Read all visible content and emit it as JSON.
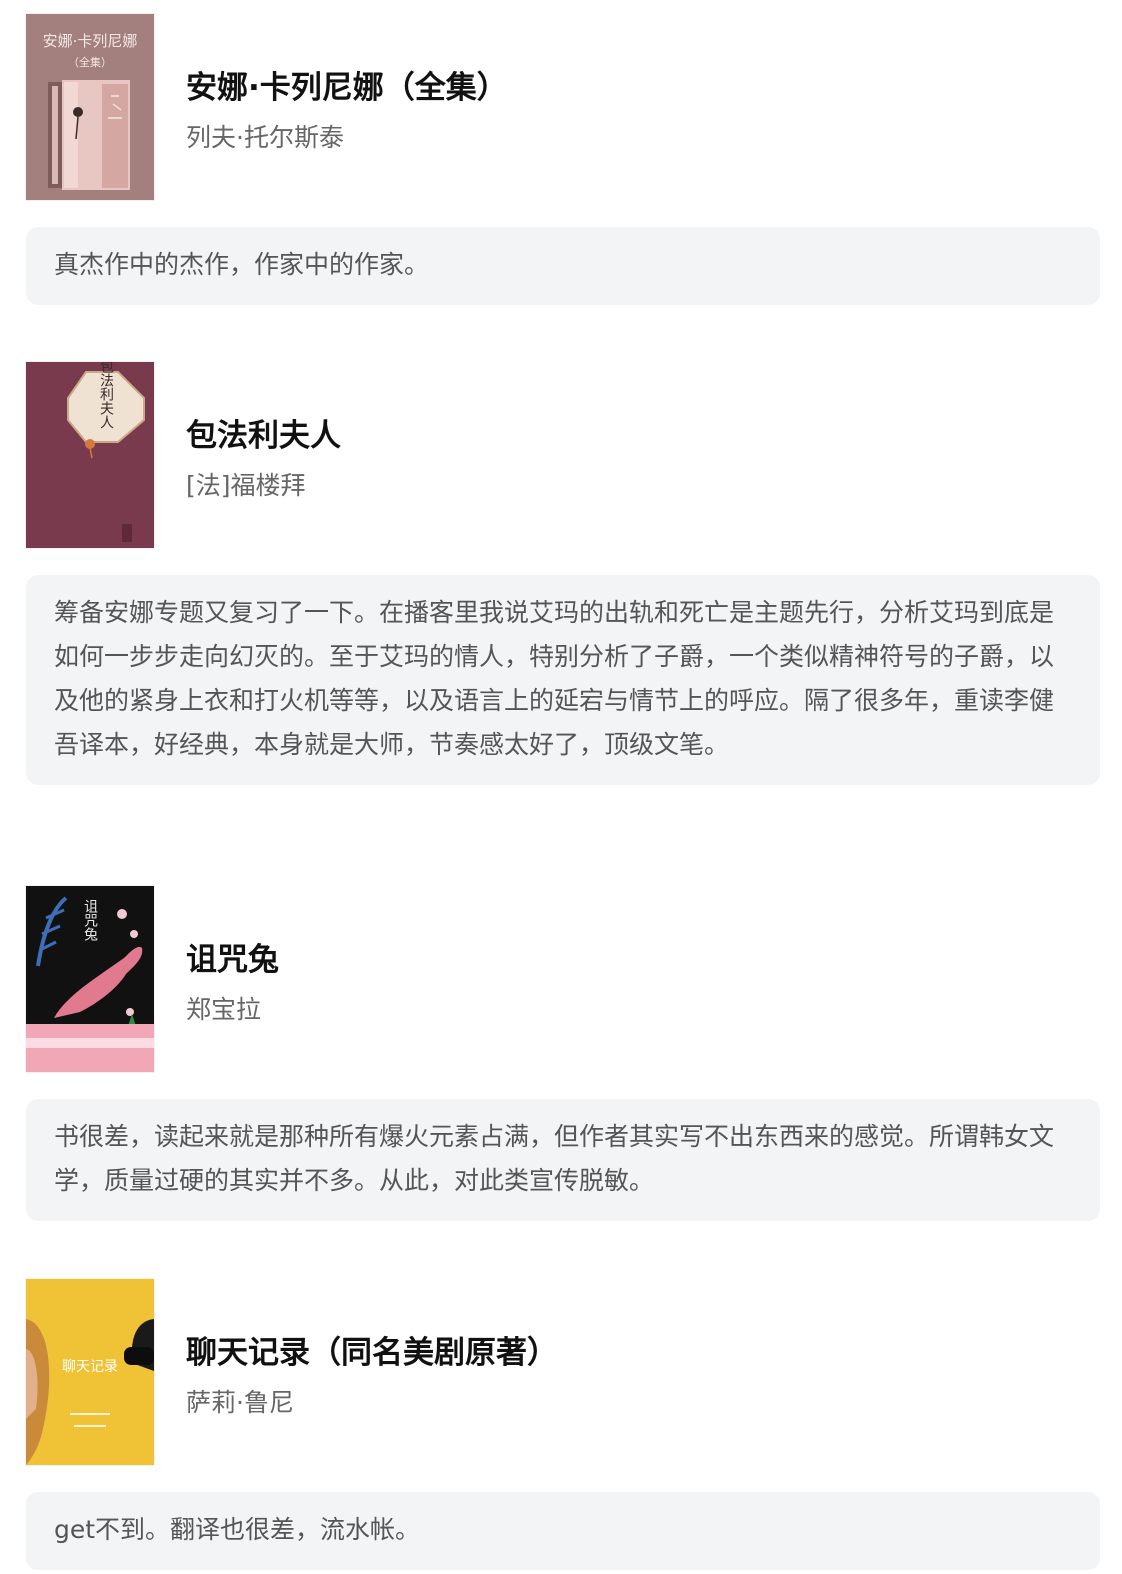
{
  "books": [
    {
      "title": "安娜·卡列尼娜（全集）",
      "author": "列夫·托尔斯泰",
      "comment": "真杰作中的杰作，作家中的作家。",
      "cover_text": "安娜·卡列尼娜",
      "cover_sub": "（全集）",
      "cover_color": "#a37f7d"
    },
    {
      "title": "包法利夫人",
      "author": "[法]福楼拜",
      "comment": "筹备安娜专题又复习了一下。在播客里我说艾玛的出轨和死亡是主题先行，分析艾玛到底是如何一步步走向幻灭的。至于艾玛的情人，特别分析了子爵，一个类似精神符号的子爵，以及他的紧身上衣和打火机等等，以及语言上的延宕与情节上的呼应。隔了很多年，重读李健吾译本，好经典，本身就是大师，节奏感太好了，顶级文笔。",
      "cover_text": "包法利夫人",
      "cover_color": "#7a3a4e"
    },
    {
      "title": "诅咒兔",
      "author": "郑宝拉",
      "comment": "书很差，读起来就是那种所有爆火元素占满，但作者其实写不出东西来的感觉。所谓韩女文学，质量过硬的其实并不多。从此，对此类宣传脱敏。",
      "cover_text": "诅咒兔",
      "cover_color": "#111111"
    },
    {
      "title": "聊天记录（同名美剧原著）",
      "author": "萨莉·鲁尼",
      "comment": "get不到。翻译也很差，流水帐。",
      "cover_text": "聊天记录",
      "cover_color": "#f0c236"
    }
  ]
}
